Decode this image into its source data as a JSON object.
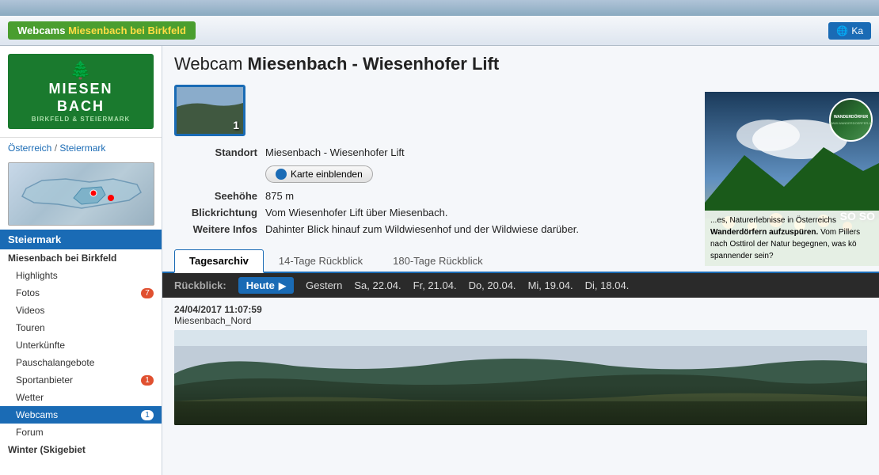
{
  "topbar": {},
  "header": {
    "breadcrumb_green": "Webcams",
    "breadcrumb_bold": "Miesenbach bei Birkfeld",
    "ka_button": "Ka"
  },
  "sidebar": {
    "logo_line1": "MIESEN",
    "logo_line2": "BACH",
    "logo_sub": "BIRKFELD & STEIERMARK",
    "region": {
      "country": "Österreich",
      "separator": "/",
      "state": "Steiermark"
    },
    "section_title": "Steiermark",
    "location_title": "Miesenbach bei Birkfeld",
    "items": [
      {
        "label": "Highlights",
        "badge": null,
        "active": false
      },
      {
        "label": "Fotos",
        "badge": "7",
        "active": false
      },
      {
        "label": "Videos",
        "badge": null,
        "active": false
      },
      {
        "label": "Touren",
        "badge": null,
        "active": false
      },
      {
        "label": "Unterkünfte",
        "badge": null,
        "active": false
      },
      {
        "label": "Pauschalangebote",
        "badge": null,
        "active": false
      },
      {
        "label": "Sportanbieter",
        "badge": "1",
        "active": false
      },
      {
        "label": "Wetter",
        "badge": null,
        "active": false
      },
      {
        "label": "Webcams",
        "badge": "1",
        "active": true
      },
      {
        "label": "Forum",
        "badge": null,
        "active": false
      }
    ],
    "extra_item": "Winter (Skigebiet"
  },
  "content": {
    "page_title_prefix": "Webcam ",
    "page_title_main": "Miesenbach - Wiesenhofer Lift",
    "webcam_number": "1",
    "standort_label": "Standort",
    "standort_value": "Miesenbach - Wiesenhofer Lift",
    "map_button_label": "Karte einblenden",
    "seehoehe_label": "Seehöhe",
    "seehoehe_value": "875 m",
    "blickrichtung_label": "Blickrichtung",
    "blickrichtung_value": "Vom Wiesenhofer Lift über Miesenbach.",
    "weitere_label": "Weitere Infos",
    "weitere_value": "Dahinter Blick hinauf zum Wildwiesenhof und der Wildwiese darüber.",
    "tabs": [
      {
        "label": "Tagesarchiv",
        "active": true
      },
      {
        "label": "14-Tage Rückblick",
        "active": false
      },
      {
        "label": "180-Tage Rückblick",
        "active": false
      }
    ],
    "archive_label": "Rückblick:",
    "archive_today": "Heute",
    "archive_dates": [
      "Gestern",
      "Sa, 22.04.",
      "Fr, 21.04.",
      "Do, 20.04.",
      "Mi, 19.04.",
      "Di, 18.04."
    ],
    "timestamp": "24/04/2017 11:07:59",
    "location_name": "Miesenbach_Nord"
  },
  "ad": {
    "logo_text": "WANDERDÖRFER",
    "url_text": "WWW.WANDERDOERFER.AT",
    "text1": "...es, Naturerlebnisse in Österreichs",
    "text2_bold": "Wanderdörfern aufzuspüren.",
    "text3": " Vom Pillers",
    "text4": "nach Osttirol der Natur begegnen, was kö",
    "text5": "spannender sein?",
    "so_text": "SO SO"
  }
}
